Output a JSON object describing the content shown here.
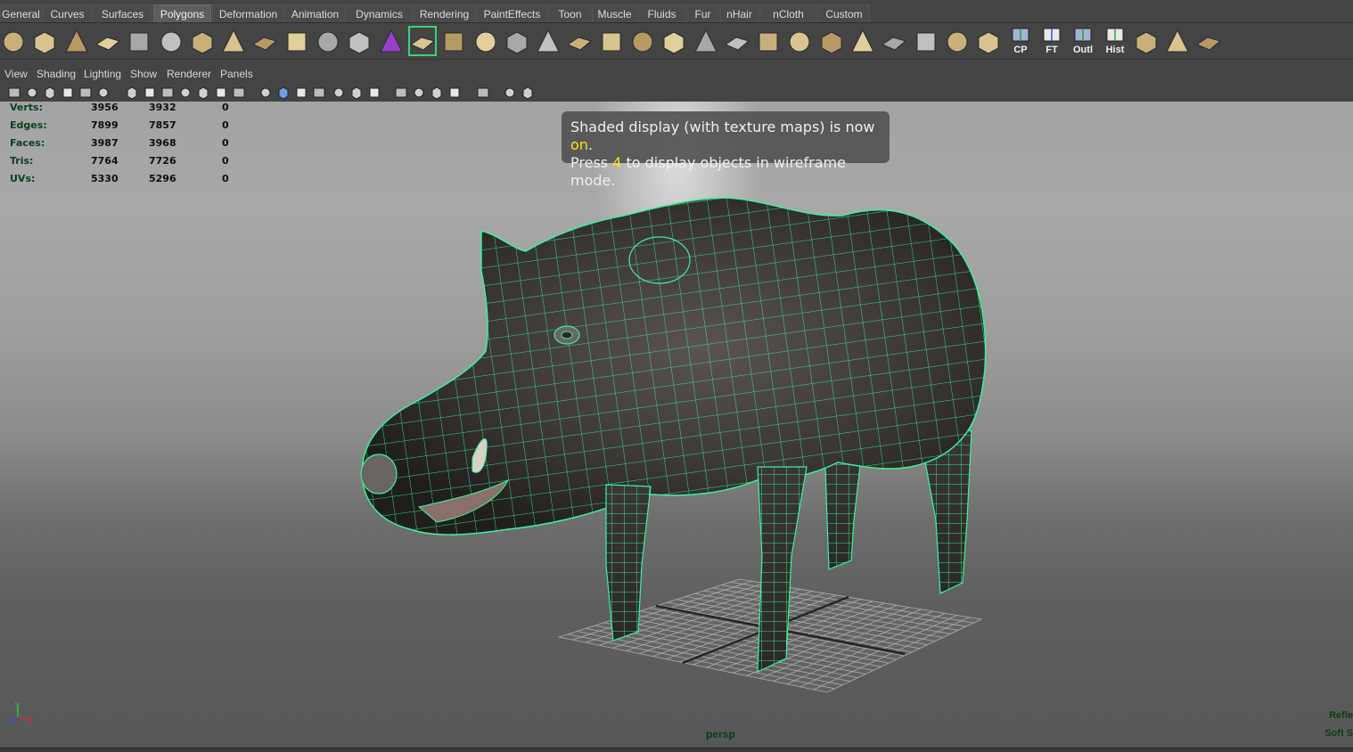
{
  "shelf_tabs": [
    {
      "label": "General",
      "active": false
    },
    {
      "label": "Curves",
      "active": false
    },
    {
      "label": "Surfaces",
      "active": false
    },
    {
      "label": "Polygons",
      "active": true
    },
    {
      "label": "Deformation",
      "active": false
    },
    {
      "label": "Animation",
      "active": false
    },
    {
      "label": "Dynamics",
      "active": false
    },
    {
      "label": "Rendering",
      "active": false
    },
    {
      "label": "PaintEffects",
      "active": false
    },
    {
      "label": "Toon",
      "active": false
    },
    {
      "label": "Muscle",
      "active": false
    },
    {
      "label": "Fluids",
      "active": false
    },
    {
      "label": "Fur",
      "active": false
    },
    {
      "label": "nHair",
      "active": false
    },
    {
      "label": "nCloth",
      "active": false
    },
    {
      "label": "Custom",
      "active": false
    }
  ],
  "shelf_tools": [
    {
      "icon": "poly-sphere-icon"
    },
    {
      "icon": "poly-cube-icon"
    },
    {
      "icon": "poly-cylinder-icon"
    },
    {
      "icon": "poly-cone-icon"
    },
    {
      "icon": "poly-plane-icon"
    },
    {
      "icon": "poly-torus-icon"
    },
    {
      "icon": "poly-pyramid-icon"
    },
    {
      "icon": "poly-pipe-icon"
    },
    {
      "icon": "poly-soccer-ball-icon"
    },
    {
      "icon": "combine-icon"
    },
    {
      "icon": "separate-icon"
    },
    {
      "icon": "smooth-icon"
    },
    {
      "icon": "mirror-cut-icon"
    },
    {
      "icon": "extrude-icon"
    },
    {
      "icon": "bridge-icon"
    },
    {
      "icon": "append-polygon-icon"
    },
    {
      "icon": "split-polygon-icon"
    },
    {
      "icon": "insert-edge-loop-icon"
    },
    {
      "icon": "offset-edge-loop-icon"
    },
    {
      "icon": "merge-vertices-icon"
    },
    {
      "icon": "bevel-icon"
    },
    {
      "icon": "poke-face-icon"
    },
    {
      "icon": "wedge-face-icon"
    },
    {
      "icon": "duplicate-face-icon"
    },
    {
      "icon": "extract-icon"
    },
    {
      "icon": "sculpt-geometry-icon"
    },
    {
      "icon": "planar-mapping-icon"
    },
    {
      "icon": "cylindrical-mapping-icon"
    },
    {
      "icon": "spherical-mapping-icon"
    },
    {
      "icon": "automatic-mapping-icon"
    },
    {
      "icon": "uv-texture-editor-icon"
    },
    {
      "icon": "checker-map-icon"
    },
    {
      "icon": "cp-icon",
      "label": "CP"
    },
    {
      "icon": "ft-icon",
      "label": "FT"
    },
    {
      "icon": "outliner-icon",
      "label": "Outl"
    },
    {
      "icon": "history-icon",
      "label": "Hist"
    },
    {
      "icon": "transfer-attributes-icon"
    },
    {
      "icon": "select-uv-shell-icon"
    },
    {
      "icon": "unfold-uv-icon"
    }
  ],
  "panel_menu": [
    "View",
    "Shading",
    "Lighting",
    "Show",
    "Renderer",
    "Panels"
  ],
  "panel_tools": [
    {
      "icon": "select-camera-icon"
    },
    {
      "icon": "camera-attributes-icon"
    },
    {
      "icon": "bookmark-icon"
    },
    {
      "icon": "image-plane-icon"
    },
    {
      "icon": "2d-pan-zoom-icon"
    },
    {
      "icon": "grease-pencil-icon"
    },
    {
      "icon": "grid-toggle-icon"
    },
    {
      "icon": "film-gate-icon"
    },
    {
      "icon": "resolution-gate-icon"
    },
    {
      "icon": "gate-mask-icon"
    },
    {
      "icon": "field-chart-icon"
    },
    {
      "icon": "safe-action-icon"
    },
    {
      "icon": "safe-title-icon"
    },
    {
      "icon": "wireframe-icon"
    },
    {
      "icon": "smooth-shade-icon"
    },
    {
      "icon": "wireframe-on-shaded-icon"
    },
    {
      "icon": "textured-icon"
    },
    {
      "icon": "use-all-lights-icon"
    },
    {
      "icon": "shadows-icon"
    },
    {
      "icon": "screen-space-ao-icon"
    },
    {
      "icon": "motion-blur-icon"
    },
    {
      "icon": "multisample-aa-icon"
    },
    {
      "icon": "depth-of-field-icon"
    },
    {
      "icon": "isolate-select-icon"
    },
    {
      "icon": "xray-icon"
    },
    {
      "icon": "xray-joints-icon"
    },
    {
      "icon": "xray-components-icon"
    }
  ],
  "hud": {
    "rows": [
      {
        "label": "Verts:",
        "a": "3956",
        "b": "3932",
        "c": "0"
      },
      {
        "label": "Edges:",
        "a": "7899",
        "b": "7857",
        "c": "0"
      },
      {
        "label": "Faces:",
        "a": "3987",
        "b": "3968",
        "c": "0"
      },
      {
        "label": "Tris:",
        "a": "7764",
        "b": "7726",
        "c": "0"
      },
      {
        "label": "UVs:",
        "a": "5330",
        "b": "5296",
        "c": "0"
      }
    ]
  },
  "notice": {
    "line1_pre": "Shaded display (with texture maps) is now ",
    "line1_hl": "on",
    "line1_post": ".",
    "line2_pre": "Press ",
    "line2_hl": "4",
    "line2_post": " to display objects in wireframe mode."
  },
  "viewport": {
    "camera": "persp",
    "corner_labels": [
      "Refle",
      "Soft S"
    ],
    "axis": {
      "y": "y",
      "x": "x",
      "z": "z"
    },
    "model": "textured-boar-mesh",
    "colors": {
      "wire": "#3df0a0",
      "hud_label": "#0a3f1f",
      "highlight": "#ffe21a",
      "x_axis": "#d03030",
      "y_axis": "#30c030",
      "z_axis": "#3050e0"
    }
  }
}
